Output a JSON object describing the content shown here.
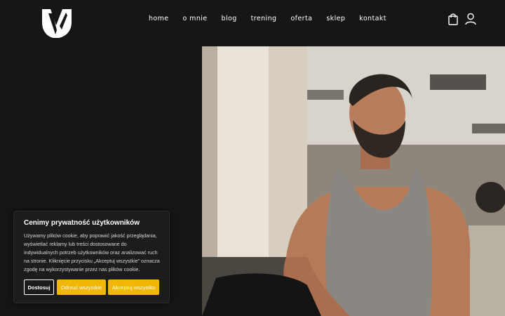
{
  "nav": {
    "items": [
      {
        "label": "home"
      },
      {
        "label": "o mnie"
      },
      {
        "label": "blog"
      },
      {
        "label": "trening"
      },
      {
        "label": "oferta"
      },
      {
        "label": "sklep"
      },
      {
        "label": "kontakt"
      }
    ]
  },
  "icons": {
    "cart": "shopping-bag-icon",
    "account": "user-icon",
    "logo": "logo-icon"
  },
  "cookie": {
    "title": "Cenimy prywatność użytkowników",
    "lines": [
      "Używamy plików cookie, aby poprawić jakość przeglądania,",
      "wyświetlać reklamy lub treści dostosowane do",
      "indywidualnych potrzeb użytkowników oraz analizować ruch",
      "na stronie. Kliknięcie przycisku „Akceptuj wszystkie” oznacza",
      "zgodę na wykorzystywanie przez nas plików cookie."
    ],
    "customize_label": "Dostosuj",
    "reject_label": "Odrzuć wszystkie",
    "accept_label": "Akceptuj wszystko"
  },
  "colors": {
    "background": "#161616",
    "accent": "#f2b705",
    "text": "#ffffff"
  }
}
